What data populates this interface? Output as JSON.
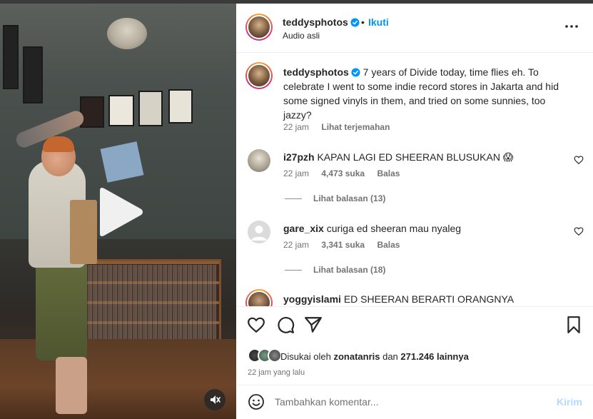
{
  "header": {
    "username": "teddysphotos",
    "verified": true,
    "separator": "•",
    "follow_label": "Ikuti",
    "audio_label": "Audio asli"
  },
  "caption": {
    "username": "teddysphotos",
    "text": "7 years of Divide today, time flies eh. To celebrate I went to some indie record stores in Jakarta and hid some signed vinyls in them, and tried on some sunnies, too jazzy?",
    "time": "22 jam",
    "translate_label": "Lihat terjemahan"
  },
  "comments": [
    {
      "username": "i27pzh",
      "text": "KAPAN LAGI ED SHEERAN BLUSUKAN",
      "emoji": "😱",
      "time": "22 jam",
      "likes": "4,473 suka",
      "reply_label": "Balas",
      "view_replies": "Lihat balasan (13)"
    },
    {
      "username": "gare_xix",
      "text": "curiga ed sheeran mau nyaleg",
      "emoji": "",
      "time": "22 jam",
      "likes": "3,341 suka",
      "reply_label": "Balas",
      "view_replies": "Lihat balasan (18)"
    },
    {
      "username": "yoggyislami",
      "text": "ED SHEERAN BERARTI ORANGNYA HUMBLE."
    }
  ],
  "actions": {
    "liked_prefix": "Disukai oleh",
    "liked_user": "zonatanris",
    "liked_mid": "dan",
    "liked_count": "271.246 lainnya",
    "posted_ago": "22 jam yang lalu"
  },
  "composer": {
    "placeholder": "Tambahkan komentar...",
    "post_label": "Kirim"
  },
  "icons": {
    "play": "play-icon",
    "mute": "speaker-muted-icon",
    "more": "more-horizontal-icon",
    "like": "heart-icon",
    "comment": "comment-icon",
    "share": "paper-plane-icon",
    "save": "bookmark-icon",
    "emoji": "smiley-icon"
  },
  "colors": {
    "accent": "#0095f6",
    "text": "#262626",
    "muted": "#737373",
    "post_disabled": "#b3dbff"
  }
}
